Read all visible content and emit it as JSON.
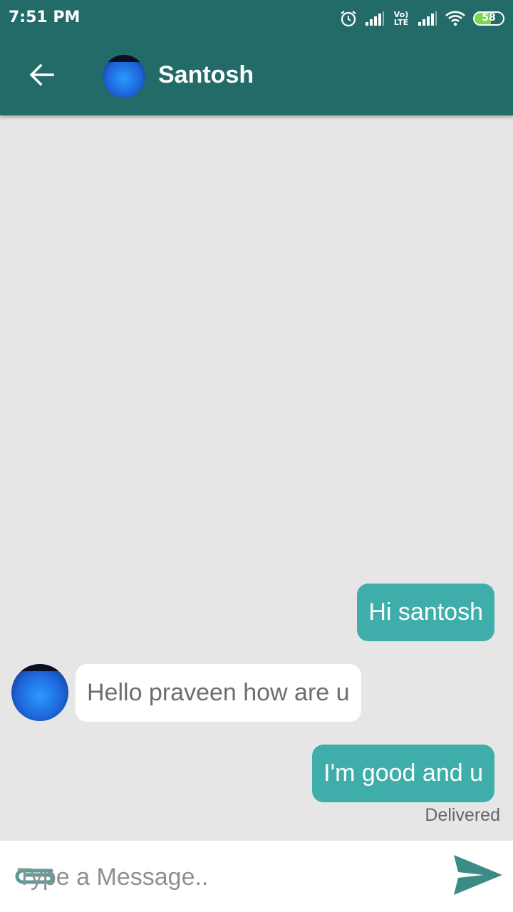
{
  "status_bar": {
    "time": "7:51 PM",
    "network_label": "Vo) LTE",
    "battery_level": "58",
    "icons": [
      "alarm-icon",
      "signal-icon",
      "volte-icon",
      "signal-icon",
      "wifi-icon",
      "battery-icon"
    ]
  },
  "header": {
    "contact_name": "Santosh",
    "icons": [
      "back-arrow-icon",
      "contact-avatar"
    ]
  },
  "messages": [
    {
      "direction": "outgoing",
      "text": "Hi santosh"
    },
    {
      "direction": "incoming",
      "text": "Hello praveen how are u"
    },
    {
      "direction": "outgoing",
      "text": "I'm good and u",
      "status": "Delivered"
    }
  ],
  "composer": {
    "placeholder": "Type a Message..",
    "value": "",
    "icons": [
      "attachment-icon",
      "send-icon"
    ]
  },
  "colors": {
    "primary": "#236b69",
    "outgoing_bubble": "#3faeaa",
    "incoming_bubble": "#ffffff",
    "chat_background": "#e6e6e6",
    "send_icon": "#3d8b86"
  }
}
